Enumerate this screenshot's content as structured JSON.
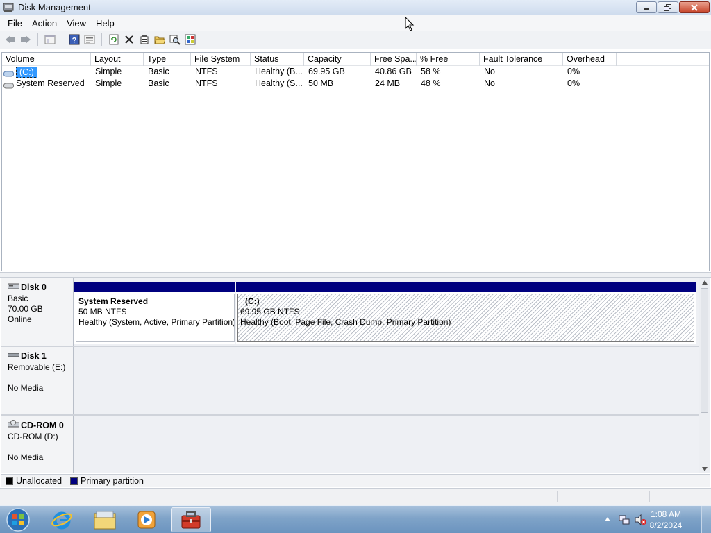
{
  "window": {
    "title": "Disk Management"
  },
  "menu": [
    "File",
    "Action",
    "View",
    "Help"
  ],
  "volume_table": {
    "columns": [
      "Volume",
      "Layout",
      "Type",
      "File System",
      "Status",
      "Capacity",
      "Free Spa...",
      "% Free",
      "Fault Tolerance",
      "Overhead"
    ],
    "rows": [
      {
        "volume": "(C:)",
        "layout": "Simple",
        "type": "Basic",
        "fs": "NTFS",
        "status": "Healthy (B...",
        "capacity": "69.95 GB",
        "free": "40.86 GB",
        "pct": "58 %",
        "fault": "No",
        "overhead": "0%"
      },
      {
        "volume": "System Reserved",
        "layout": "Simple",
        "type": "Basic",
        "fs": "NTFS",
        "status": "Healthy (S...",
        "capacity": "50 MB",
        "free": "24 MB",
        "pct": "48 %",
        "fault": "No",
        "overhead": "0%"
      }
    ]
  },
  "disks": [
    {
      "name": "Disk 0",
      "line1": "Basic",
      "line2": "70.00 GB",
      "line3": "Online",
      "partitions": [
        {
          "name": "System Reserved",
          "size": "50 MB NTFS",
          "status": "Healthy (System, Active, Primary Partition)"
        },
        {
          "name": "(C:)",
          "size": "69.95 GB NTFS",
          "status": "Healthy (Boot, Page File, Crash Dump, Primary Partition)"
        }
      ]
    },
    {
      "name": "Disk 1",
      "line1": "Removable (E:)",
      "line2": "",
      "line3": "No Media"
    },
    {
      "name": "CD-ROM 0",
      "line1": "CD-ROM (D:)",
      "line2": "",
      "line3": "No Media"
    }
  ],
  "legend": [
    "Unallocated",
    "Primary partition"
  ],
  "colors": {
    "unallocated": "#000000",
    "primary": "#00007f",
    "selection": "#3399ff"
  },
  "clock": {
    "time": "1:08 AM",
    "date": "8/2/2024"
  }
}
